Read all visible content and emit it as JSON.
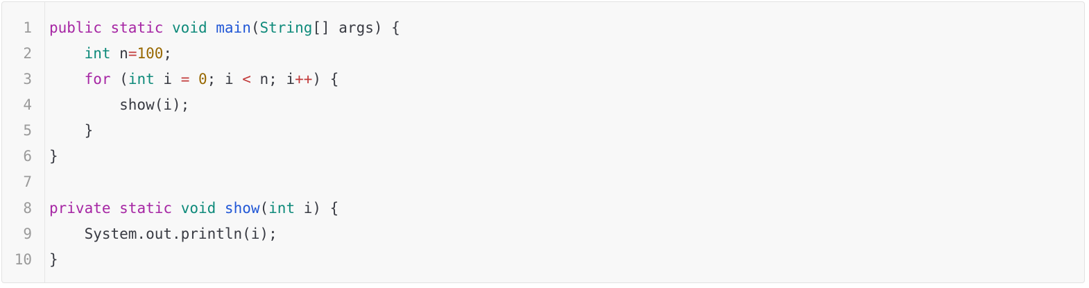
{
  "code_block": {
    "lines": [
      {
        "number": "1",
        "tokens": [
          {
            "t": "public",
            "c": "kw"
          },
          {
            "t": " ",
            "c": "plain"
          },
          {
            "t": "static",
            "c": "kw"
          },
          {
            "t": " ",
            "c": "plain"
          },
          {
            "t": "void",
            "c": "type"
          },
          {
            "t": " ",
            "c": "plain"
          },
          {
            "t": "main",
            "c": "fn"
          },
          {
            "t": "(",
            "c": "plain"
          },
          {
            "t": "String",
            "c": "type"
          },
          {
            "t": "[] args) {",
            "c": "plain"
          }
        ]
      },
      {
        "number": "2",
        "tokens": [
          {
            "t": "    ",
            "c": "plain"
          },
          {
            "t": "int",
            "c": "type"
          },
          {
            "t": " n",
            "c": "plain"
          },
          {
            "t": "=",
            "c": "op"
          },
          {
            "t": "100",
            "c": "num"
          },
          {
            "t": ";",
            "c": "plain"
          }
        ]
      },
      {
        "number": "3",
        "tokens": [
          {
            "t": "    ",
            "c": "plain"
          },
          {
            "t": "for",
            "c": "kw"
          },
          {
            "t": " (",
            "c": "plain"
          },
          {
            "t": "int",
            "c": "type"
          },
          {
            "t": " i ",
            "c": "plain"
          },
          {
            "t": "=",
            "c": "op"
          },
          {
            "t": " ",
            "c": "plain"
          },
          {
            "t": "0",
            "c": "num"
          },
          {
            "t": "; i ",
            "c": "plain"
          },
          {
            "t": "<",
            "c": "op"
          },
          {
            "t": " n; i",
            "c": "plain"
          },
          {
            "t": "++",
            "c": "op"
          },
          {
            "t": ") {",
            "c": "plain"
          }
        ]
      },
      {
        "number": "4",
        "tokens": [
          {
            "t": "        show(i);",
            "c": "plain"
          }
        ]
      },
      {
        "number": "5",
        "tokens": [
          {
            "t": "    }",
            "c": "plain"
          }
        ]
      },
      {
        "number": "6",
        "tokens": [
          {
            "t": "}",
            "c": "plain"
          }
        ]
      },
      {
        "number": "7",
        "tokens": []
      },
      {
        "number": "8",
        "tokens": [
          {
            "t": "private",
            "c": "kw"
          },
          {
            "t": " ",
            "c": "plain"
          },
          {
            "t": "static",
            "c": "kw"
          },
          {
            "t": " ",
            "c": "plain"
          },
          {
            "t": "void",
            "c": "type"
          },
          {
            "t": " ",
            "c": "plain"
          },
          {
            "t": "show",
            "c": "fn"
          },
          {
            "t": "(",
            "c": "plain"
          },
          {
            "t": "int",
            "c": "type"
          },
          {
            "t": " i) {",
            "c": "plain"
          }
        ]
      },
      {
        "number": "9",
        "tokens": [
          {
            "t": "    System.out.println(i);",
            "c": "plain"
          }
        ]
      },
      {
        "number": "10",
        "tokens": [
          {
            "t": "}",
            "c": "plain"
          }
        ]
      }
    ]
  },
  "colors": {
    "keyword": "#a626a4",
    "type": "#0e8a7a",
    "function": "#2157d6",
    "operator": "#c23a3a",
    "number": "#986801",
    "plain": "#383a42",
    "line_number": "#9a9a9a",
    "background": "#f8f8f8"
  }
}
